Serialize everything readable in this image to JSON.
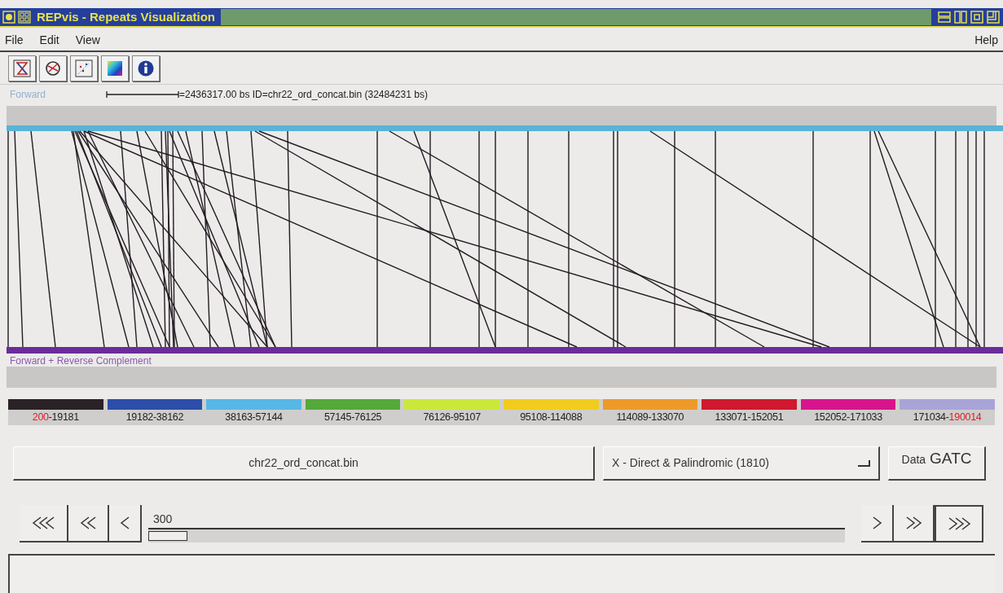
{
  "window": {
    "title": "REPvis - Repeats Visualization"
  },
  "menu": [
    {
      "label": "File"
    },
    {
      "label": "Edit"
    },
    {
      "label": "View"
    },
    {
      "label": "Help"
    }
  ],
  "scale": {
    "label": "=2436317.00 bs  ID=chr22_ord_concat.bin (32484231 bs)"
  },
  "tracks": {
    "forward_label": "Forward",
    "reverse_label": "Forward + Reverse Complement"
  },
  "legend": {
    "separator": "-",
    "items": [
      {
        "from": "200",
        "to": "19181",
        "color": "#2a2226",
        "from_marked": true,
        "to_marked": false
      },
      {
        "from": "19182",
        "to": "38162",
        "color": "#2c4ea8",
        "from_marked": false,
        "to_marked": false
      },
      {
        "from": "38163",
        "to": "57144",
        "color": "#57b7e6",
        "from_marked": false,
        "to_marked": false
      },
      {
        "from": "57145",
        "to": "76125",
        "color": "#55a83a",
        "from_marked": false,
        "to_marked": false
      },
      {
        "from": "76126",
        "to": "95107",
        "color": "#c9e83a",
        "from_marked": false,
        "to_marked": false
      },
      {
        "from": "95108",
        "to": "114088",
        "color": "#f2cc1c",
        "from_marked": false,
        "to_marked": false
      },
      {
        "from": "114089",
        "to": "133070",
        "color": "#ee9a2a",
        "from_marked": false,
        "to_marked": false
      },
      {
        "from": "133071",
        "to": "152051",
        "color": "#d0182e",
        "from_marked": false,
        "to_marked": false
      },
      {
        "from": "152052",
        "to": "171033",
        "color": "#d8148c",
        "from_marked": false,
        "to_marked": false
      },
      {
        "from": "171034",
        "to": "190014",
        "color": "#a9a4d8",
        "from_marked": false,
        "to_marked": true
      }
    ]
  },
  "file_button": {
    "label": "chr22_ord_concat.bin"
  },
  "type_dropdown": {
    "value": "X - Direct & Palindromic (1810)"
  },
  "data_button": {
    "label": "Data",
    "strong": "GATC"
  },
  "slider": {
    "value": "300",
    "level": 0
  }
}
